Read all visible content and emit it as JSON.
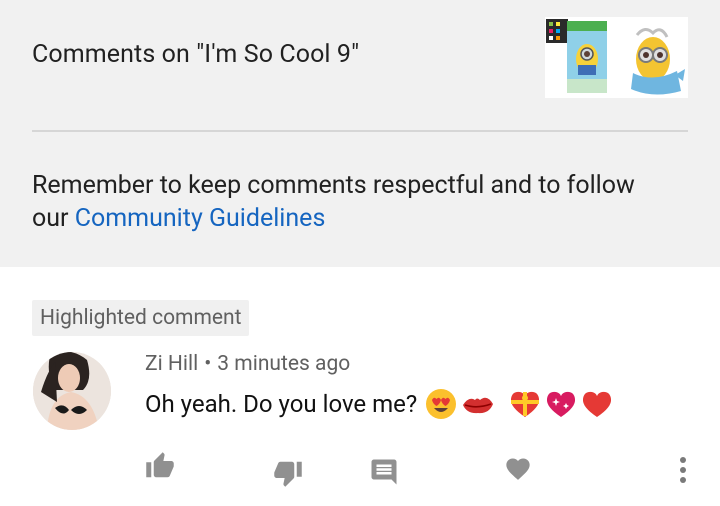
{
  "header": {
    "title": "Comments on \"I'm So Cool 9\"",
    "thumbnail_icon": "video-thumbnail-minions",
    "reminder_text": "Remember to keep comments respectful and to follow our ",
    "guidelines_link": "Community Guidelines"
  },
  "comment": {
    "badge": "Highlighted comment",
    "author": "Zi Hill",
    "separator": "•",
    "time": "3 minutes ago",
    "text": "Oh yeah. Do you love me?",
    "emojis": [
      "heart-eyes-emoji",
      "kiss-mark-emoji",
      "heart-with-ribbon-emoji",
      "sparkling-heart-emoji",
      "red-heart-emoji"
    ]
  },
  "actions": {
    "like_icon": "thumb-up-icon",
    "dislike_icon": "thumb-down-icon",
    "reply_icon": "comment-reply-icon",
    "heart_icon": "heart-icon",
    "more_icon": "more-vert-icon"
  },
  "colors": {
    "header_bg": "#f1f1f1",
    "link": "#1565c0",
    "secondary_text": "#606060",
    "icon": "#909090",
    "badge_bg": "#f0f0f0"
  }
}
